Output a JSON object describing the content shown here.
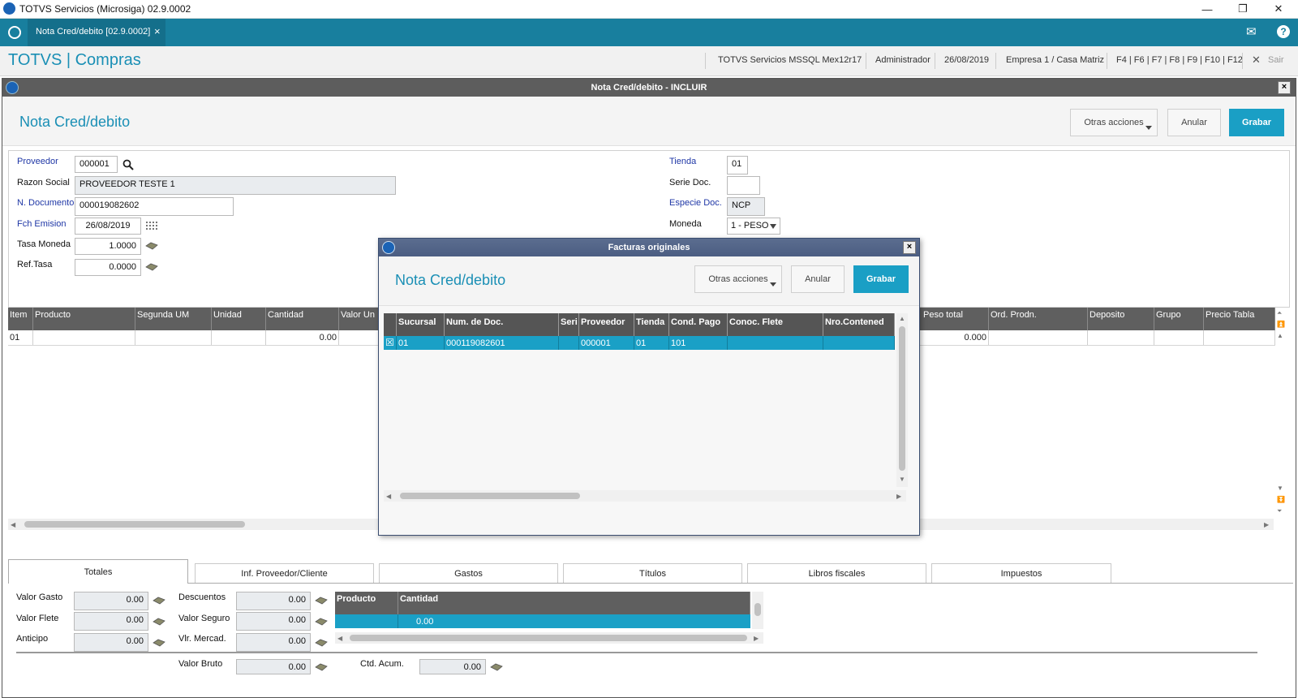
{
  "titlebar": {
    "title": "TOTVS Servicios (Microsiga) 02.9.0002",
    "min": "—",
    "restore": "❐",
    "close": "✕"
  },
  "tabbar": {
    "tab_label": "Nota Cred/debito [02.9.0002]",
    "tab_close": "×",
    "mail": "✉",
    "help": "?"
  },
  "header": {
    "brand": "TOTVS | Compras",
    "server": "TOTVS Servicios MSSQL Mex12r17",
    "user": "Administrador",
    "date": "26/08/2019",
    "company": "Empresa 1 / Casa Matriz",
    "shortcuts": "F4 | F6 | F7 | F8 | F9 | F10 | F12",
    "exit": "Sair",
    "exit_icon": "✕"
  },
  "window": {
    "title": "Nota Cred/debito - INCLUIR",
    "close": "×",
    "page_title": "Nota Cred/debito",
    "btn_other": "Otras acciones",
    "btn_cancel": "Anular",
    "btn_save": "Grabar"
  },
  "form": {
    "proveedor_label": "Proveedor",
    "proveedor_value": "000001",
    "razon_label": "Razon Social",
    "razon_value": "PROVEEDOR TESTE 1",
    "ndoc_label": "N. Documento",
    "ndoc_value": "000019082602",
    "fch_label": "Fch Emision",
    "fch_value": "26/08/2019",
    "tasa_label": "Tasa Moneda",
    "tasa_value": "1.0000",
    "reftasa_label": "Ref.Tasa",
    "reftasa_value": "0.0000",
    "tienda_label": "Tienda",
    "tienda_value": "01",
    "serie_label": "Serie Doc.",
    "serie_value": "",
    "especie_label": "Especie Doc.",
    "especie_value": "NCP",
    "moneda_label": "Moneda",
    "moneda_value": "1 - PESO"
  },
  "items_grid": {
    "headers": [
      "Item",
      "Producto",
      "Segunda UM",
      "Unidad",
      "Cantidad",
      "Valor Un",
      "Peso total",
      "Ord. Prodn.",
      "Deposito",
      "Grupo",
      "Precio Tabla"
    ],
    "row": [
      "01",
      "",
      "",
      "",
      "0.00",
      "",
      "0.000",
      "",
      "",
      "",
      ""
    ]
  },
  "tabs": [
    "Totales",
    "Inf. Proveedor/Cliente",
    "Gastos",
    "Títulos",
    "Libros fiscales",
    "Impuestos"
  ],
  "totales": {
    "valor_gasto_label": "Valor Gasto",
    "valor_gasto": "0.00",
    "valor_flete_label": "Valor Flete",
    "valor_flete": "0.00",
    "anticipo_label": "Anticipo",
    "anticipo": "0.00",
    "descuentos_label": "Descuentos",
    "descuentos": "0.00",
    "valor_seguro_label": "Valor Seguro",
    "valor_seguro": "0.00",
    "vlr_mercad_label": "Vlr. Mercad.",
    "vlr_mercad": "0.00",
    "valor_bruto_label": "Valor Bruto",
    "valor_bruto": "0.00",
    "ctd_acum_label": "Ctd. Acum.",
    "ctd_acum": "0.00",
    "mini_headers": [
      "Producto",
      "Cantidad"
    ],
    "mini_row": [
      "",
      "0.00"
    ]
  },
  "modal": {
    "title": "Facturas originales",
    "close": "×",
    "page_title": "Nota Cred/debito",
    "btn_other": "Otras acciones",
    "btn_cancel": "Anular",
    "btn_save": "Grabar",
    "headers": [
      "Sucursal",
      "Num. de Doc.",
      "Seri",
      "Proveedor",
      "Tienda",
      "Cond. Pago",
      "Conoc. Flete",
      "Nro.Contened"
    ],
    "row": [
      "01",
      "000119082601",
      "",
      "000001",
      "01",
      "101",
      "",
      ""
    ],
    "row_check": "☒"
  }
}
